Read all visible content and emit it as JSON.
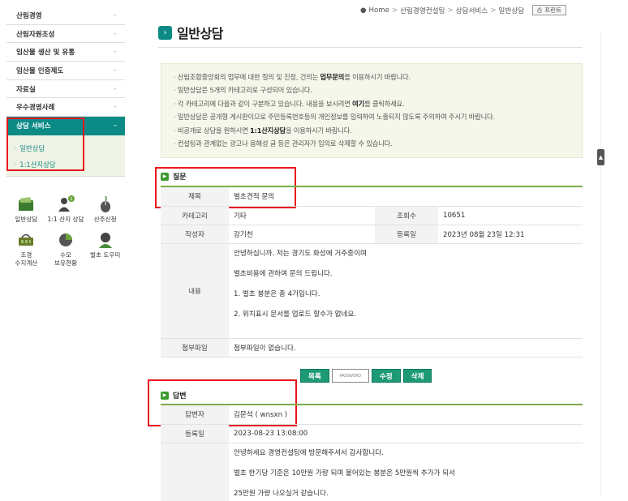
{
  "sidebar": {
    "items": [
      {
        "label": "산림경영",
        "mark": "–"
      },
      {
        "label": "산림자원조성",
        "mark": "–"
      },
      {
        "label": "임산물 생산 및 유통",
        "mark": "–"
      },
      {
        "label": "임산물 인증제도",
        "mark": "–"
      },
      {
        "label": "자료실",
        "mark": "–"
      },
      {
        "label": "우수경영사례",
        "mark": "–"
      },
      {
        "label": "상담 서비스",
        "mark": "–"
      }
    ],
    "subitems": [
      {
        "label": "일반상담"
      },
      {
        "label": "1:1산지상담"
      }
    ],
    "quick": [
      {
        "label": "일반상담",
        "icon": "folder-icon"
      },
      {
        "label": "1:1 산지 상담",
        "icon": "person-consult-icon"
      },
      {
        "label": "산주신청",
        "icon": "mouse-icon"
      },
      {
        "label": "조경\n수지계산",
        "line1": "조경",
        "line2": "수지계산",
        "icon": "basket-icon"
      },
      {
        "label": "수모\n보유현황",
        "line1": "수모",
        "line2": "보유현황",
        "icon": "pie-chart-icon"
      },
      {
        "label": "벌초 도우미",
        "icon": "helper-person-icon"
      }
    ]
  },
  "breadcrumb": {
    "home": "Home",
    "level1": "산림경영컨설팅",
    "level2": "상담서비스",
    "level3": "일반상담",
    "print": "프린트"
  },
  "page": {
    "title": "일반상담"
  },
  "notice": {
    "line1_pre": "산림조합중앙회의 업무에 대한 질의 및 진정, 건의는 ",
    "line1_bold": "업무문의",
    "line1_post": "를 이용하시기 바랍니다.",
    "line2": "일반상담은 5개의 카테고리로 구성되어 있습니다.",
    "line3_pre": "각 카테고리에 다음과 같이 구분하고 있습니다. 내용을 보시려면 ",
    "line3_bold": "여기",
    "line3_post": "를 클릭하세요.",
    "line4": "일반상담은 공개형 게시판이므로 주민등록번호등의 개인정보를 입력하여 노출되지 않도록 주의하여 주시기 바랍니다.",
    "line5_pre": "비공개로 상담을 원하시면 ",
    "line5_bold": "1:1산지상담",
    "line5_post": "을 이용하시기 바랍니다.",
    "line6": "컨설팅과 관계없는 광고나 음해성 글 등은 관리자가 임의로 삭제할 수 있습니다."
  },
  "question": {
    "section_title": "질문",
    "subject_label": "제목",
    "subject": "벌초견적 문의",
    "category_label": "카테고리",
    "category": "기타",
    "views_label": "조회수",
    "views": "10651",
    "author_label": "작성자",
    "author": "강기천",
    "date_label": "등록일",
    "date": "2023년 08월 23일 12:31",
    "content_label": "내용",
    "content": [
      "안녕하십니까. 저는 경기도 화성에 거주중이며",
      "벌초비용에 관하여 문의 드립니다.",
      "1. 벌초 봉분은 총 4기입니다.",
      "2. 위치표시 문서를 업로드 할수가 없네요."
    ],
    "attach_label": "첨부파일",
    "attach": "첨부파일이 없습니다."
  },
  "buttons": {
    "list": "목록",
    "password_placeholder": "PASSWORD",
    "edit": "수정",
    "delete": "삭제"
  },
  "answer": {
    "section_title": "답변",
    "responder_label": "답변자",
    "responder": "김문석 ( wnsxn )",
    "date_label": "등록일",
    "date": "2023-08-23 13:08:00",
    "content": [
      "안녕하세요 경영컨설팅에 방문해주셔서 감사합니다.",
      "벌초 한기당 기준은 10만원 가량 되며 붙어있는 봉분은 5만원씩 추가가 되서",
      "25만원 가량 나오실거 같습니다."
    ]
  },
  "colors": {
    "accent": "#0c8b86",
    "section_green": "#7cae4a",
    "button_green": "#1d9a75",
    "highlight_red": "#e8161d"
  }
}
